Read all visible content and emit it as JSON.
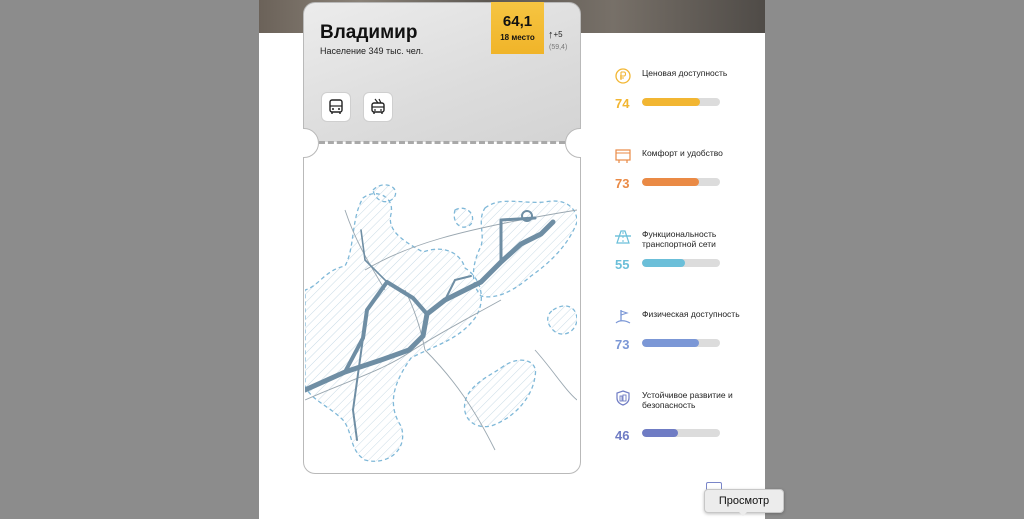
{
  "city": {
    "name": "Владимир",
    "population": "Население 349 тыс. чел.",
    "score": "64,1",
    "rank": "18 место",
    "delta": "+5",
    "previous_score": "(59,4)",
    "transport": [
      {
        "icon": "bus-icon"
      },
      {
        "icon": "trolleybus-icon"
      }
    ]
  },
  "metrics": [
    {
      "label": "Ценовая доступность",
      "value": "74",
      "fraction": 0.74,
      "color": "#f2b632",
      "icon": "ruble-coin-icon"
    },
    {
      "label": "Комфорт и удобство",
      "value": "73",
      "fraction": 0.73,
      "color": "#ea8a45",
      "icon": "bus-stop-icon"
    },
    {
      "label": "Функциональность транспортной сети",
      "value": "55",
      "fraction": 0.55,
      "color": "#6bbfd9",
      "icon": "road-network-icon"
    },
    {
      "label": "Физическая доступность",
      "value": "73",
      "fraction": 0.73,
      "color": "#7b97d6",
      "icon": "accessibility-icon"
    },
    {
      "label": "Устойчивое развитие и безопасность",
      "value": "46",
      "fraction": 0.46,
      "color": "#6f7cc4",
      "icon": "shield-icon"
    }
  ],
  "tooltip": {
    "text": "Просмотр"
  }
}
